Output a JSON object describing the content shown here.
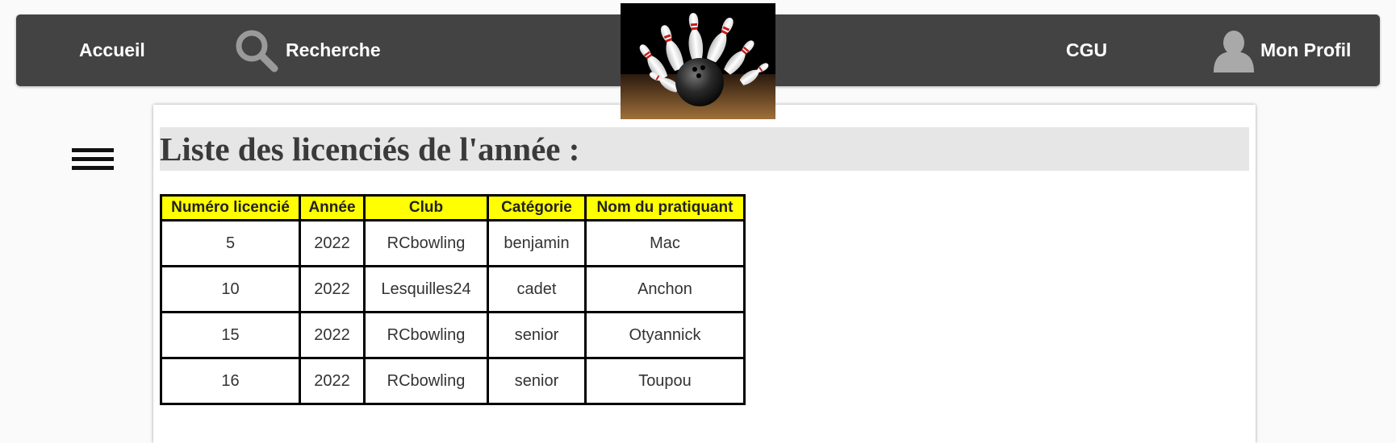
{
  "nav": {
    "home": "Accueil",
    "search": "Recherche",
    "cgu": "CGU",
    "profile": "Mon Profil",
    "search_icon": "magnifier-icon",
    "profile_icon": "user-silhouette-icon"
  },
  "logo": {
    "icon": "bowling-logo"
  },
  "main": {
    "title": "Liste des licenciés de l'année :",
    "table": {
      "headers": [
        "Numéro licencié",
        "Année",
        "Club",
        "Catégorie",
        "Nom du pratiquant"
      ],
      "rows": [
        [
          "5",
          "2022",
          "RCbowling",
          "benjamin",
          "Mac"
        ],
        [
          "10",
          "2022",
          "Lesquilles24",
          "cadet",
          "Anchon"
        ],
        [
          "15",
          "2022",
          "RCbowling",
          "senior",
          "Otyannick"
        ],
        [
          "16",
          "2022",
          "RCbowling",
          "senior",
          "Toupou"
        ]
      ]
    }
  },
  "colors": {
    "navbar": "#434343",
    "header_bg": "#ffff00",
    "title_bg": "#e6e6e6"
  }
}
